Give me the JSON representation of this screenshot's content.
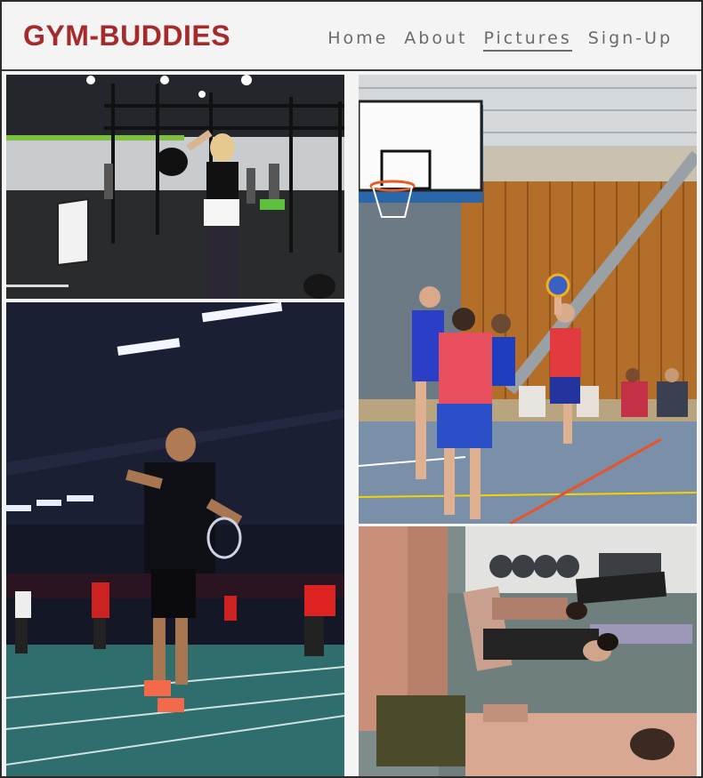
{
  "brand": {
    "name": "GYM-BUDDIES",
    "color": "#a52a2a"
  },
  "nav": {
    "items": [
      {
        "label": "Home",
        "active": false
      },
      {
        "label": "About",
        "active": false
      },
      {
        "label": "Pictures",
        "active": true
      },
      {
        "label": "Sign-Up",
        "active": false
      }
    ]
  },
  "gallery": {
    "photos": [
      {
        "subject": "crossfit-gym-workout"
      },
      {
        "subject": "badminton-court-player"
      },
      {
        "subject": "indoor-basketball-game"
      },
      {
        "subject": "people-lying-on-gym-floor"
      }
    ]
  }
}
